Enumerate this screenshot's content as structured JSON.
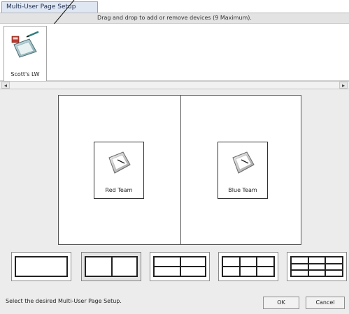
{
  "window": {
    "title": "Multi-User Page Setup"
  },
  "instruction": "Drag and drop to add or remove devices (9 Maximum).",
  "devices": [
    {
      "label": "Scott's LW",
      "icon": "device-pen-pad-icon"
    }
  ],
  "preview": {
    "cards": [
      {
        "label": "Red Team",
        "icon": "tablet-device-icon"
      },
      {
        "label": "Blue Team",
        "icon": "tablet-device-icon"
      }
    ]
  },
  "layouts": {
    "options": [
      {
        "id": "single",
        "rows": 1,
        "cols": 1
      },
      {
        "id": "two-up",
        "rows": 1,
        "cols": 2
      },
      {
        "id": "four-up",
        "rows": 2,
        "cols": 2
      },
      {
        "id": "six-up",
        "rows": 2,
        "cols": 3
      },
      {
        "id": "nine-up",
        "rows": 3,
        "cols": 3
      }
    ],
    "selected_index": 1
  },
  "footer": {
    "status": "Select the desired Multi-User Page Setup.",
    "ok_label": "OK",
    "cancel_label": "Cancel"
  },
  "scrollbar": {
    "left_arrow": "◂",
    "right_arrow": "▸"
  },
  "colors": {
    "title_tab_bg": "#dfe7f3",
    "panel_bg": "#ececec",
    "border_dark": "#555555"
  }
}
